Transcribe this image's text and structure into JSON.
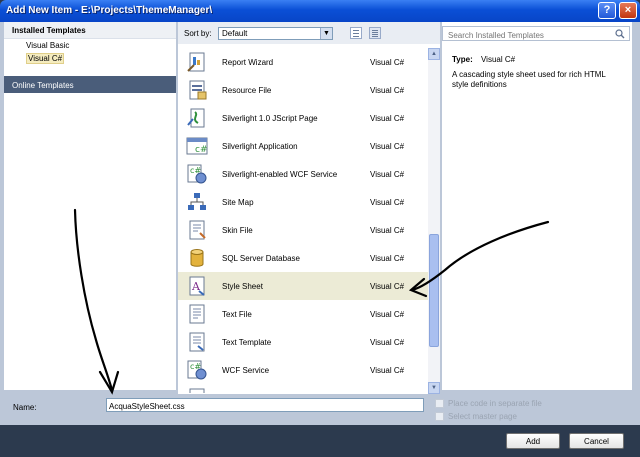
{
  "window": {
    "title": "Add New Item - E:\\Projects\\ThemeManager\\"
  },
  "titlebar": {
    "help_glyph": "?",
    "close_glyph": "×"
  },
  "sidebar": {
    "installed_header": "Installed Templates",
    "items": [
      {
        "label": "Visual Basic",
        "selected": false
      },
      {
        "label": "Visual C#",
        "selected": true
      }
    ],
    "online_header": "Online Templates"
  },
  "toolbar": {
    "sort_label": "Sort by:",
    "sort_value": "Default",
    "dropdown_glyph": "▼"
  },
  "templates": [
    {
      "name": "Report Wizard",
      "lang": "Visual C#",
      "icon": "report-wizard-icon"
    },
    {
      "name": "Resource File",
      "lang": "Visual C#",
      "icon": "resource-file-icon"
    },
    {
      "name": "Silverlight 1.0 JScript Page",
      "lang": "Visual C#",
      "icon": "jscript-page-icon"
    },
    {
      "name": "Silverlight Application",
      "lang": "Visual C#",
      "icon": "silverlight-app-icon"
    },
    {
      "name": "Silverlight-enabled WCF Service",
      "lang": "Visual C#",
      "icon": "wcf-service-icon"
    },
    {
      "name": "Site Map",
      "lang": "Visual C#",
      "icon": "site-map-icon"
    },
    {
      "name": "Skin File",
      "lang": "Visual C#",
      "icon": "skin-file-icon"
    },
    {
      "name": "SQL Server Database",
      "lang": "Visual C#",
      "icon": "database-icon"
    },
    {
      "name": "Style Sheet",
      "lang": "Visual C#",
      "icon": "style-sheet-icon",
      "selected": true
    },
    {
      "name": "Text File",
      "lang": "Visual C#",
      "icon": "text-file-icon"
    },
    {
      "name": "Text Template",
      "lang": "Visual C#",
      "icon": "text-template-icon"
    },
    {
      "name": "WCF Service",
      "lang": "Visual C#",
      "icon": "wcf-service-icon"
    },
    {
      "name": "",
      "lang": "",
      "icon": "partial-item-icon"
    }
  ],
  "scrollbar": {
    "up_glyph": "▲",
    "down_glyph": "▼"
  },
  "details": {
    "search_placeholder": "Search Installed Templates",
    "type_label": "Type:",
    "type_value": "Visual C#",
    "description": "A cascading style sheet used for rich HTML style definitions"
  },
  "form": {
    "name_label": "Name:",
    "name_value": "AcquaStyleSheet.css",
    "option1": "Place code in separate file",
    "option2": "Select master page"
  },
  "buttons": {
    "add": "Add",
    "cancel": "Cancel"
  },
  "colors": {
    "title_bar": "#0a4fd6",
    "dialog_body": "#bcc7d8",
    "footer": "#2c3a4e",
    "online_templates": "#4a5d7a",
    "selected_row": "#ecebd6",
    "annotation_ink": "#000000"
  }
}
